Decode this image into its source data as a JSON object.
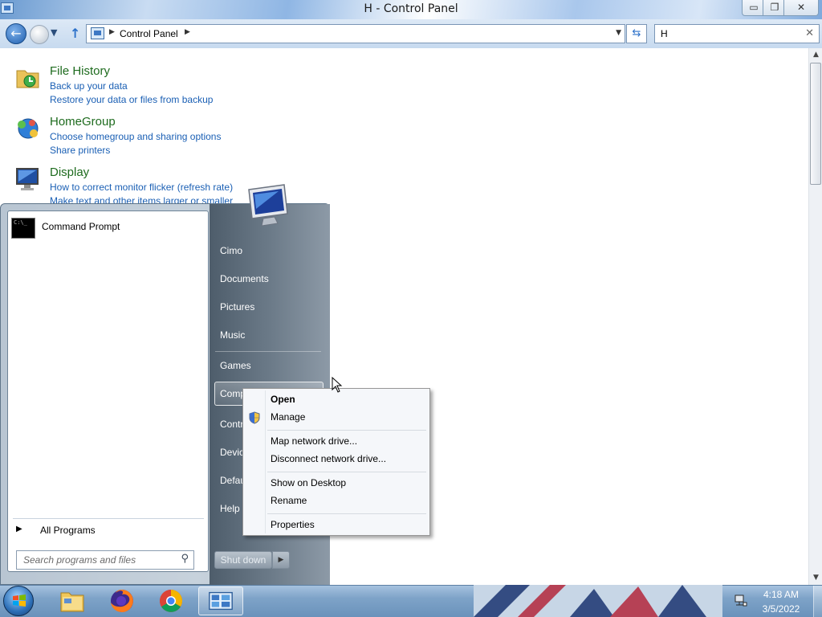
{
  "window": {
    "title": "H - Control Panel",
    "buttons": {
      "minimize": "▭",
      "maximize": "❐",
      "close": "✕"
    }
  },
  "address_bar": {
    "breadcrumb": [
      "Control Panel"
    ],
    "search_value": "H",
    "icons": {
      "back": "back-arrow-icon",
      "forward": "forward-arrow-icon",
      "up": "up-arrow-icon",
      "refresh": "refresh-icon",
      "clear": "close-icon"
    }
  },
  "results": [
    {
      "title": "File History",
      "icon": "file-history-icon",
      "links": [
        "Back up your data",
        "Restore your data or files from backup"
      ]
    },
    {
      "title": "HomeGroup",
      "icon": "homegroup-icon",
      "links": [
        "Choose homegroup and sharing options",
        "Share printers"
      ]
    },
    {
      "title": "Display",
      "icon": "display-icon",
      "links": [
        "How to correct monitor flicker (refresh rate)",
        "Make text and other items larger or smaller"
      ]
    }
  ],
  "start_menu": {
    "pinned": [
      {
        "label": "Command Prompt",
        "icon": "command-prompt-icon"
      }
    ],
    "all_programs": "All Programs",
    "search_placeholder": "Search programs and files",
    "right_items": [
      "Cimo",
      "Documents",
      "Pictures",
      "Music",
      "Games",
      "Computer",
      "Control Panel",
      "Devices and Printers",
      "Default Programs",
      "Help and Support"
    ],
    "right_items_visible": [
      "Cimo",
      "Documents",
      "Pictures",
      "Music",
      "Games",
      "Comp",
      "Contr",
      "Devic",
      "Defau",
      "Help"
    ],
    "shutdown": "Shut down"
  },
  "context_menu": {
    "items": [
      {
        "label": "Open",
        "bold": true
      },
      {
        "label": "Manage",
        "icon": "uac-shield-icon"
      },
      {
        "label": "Map network drive..."
      },
      {
        "label": "Disconnect network drive..."
      },
      {
        "label": "Show on Desktop"
      },
      {
        "label": "Rename"
      },
      {
        "label": "Properties"
      }
    ]
  },
  "taskbar": {
    "apps": [
      "file-explorer-icon",
      "firefox-icon",
      "chrome-icon",
      "control-panel-icon"
    ],
    "clock_time": "4:18 AM",
    "clock_date": "3/5/2022"
  },
  "colors": {
    "result_title": "#1e6b1e",
    "link": "#1a5fb4",
    "taskbar": "#7ea3c8"
  }
}
